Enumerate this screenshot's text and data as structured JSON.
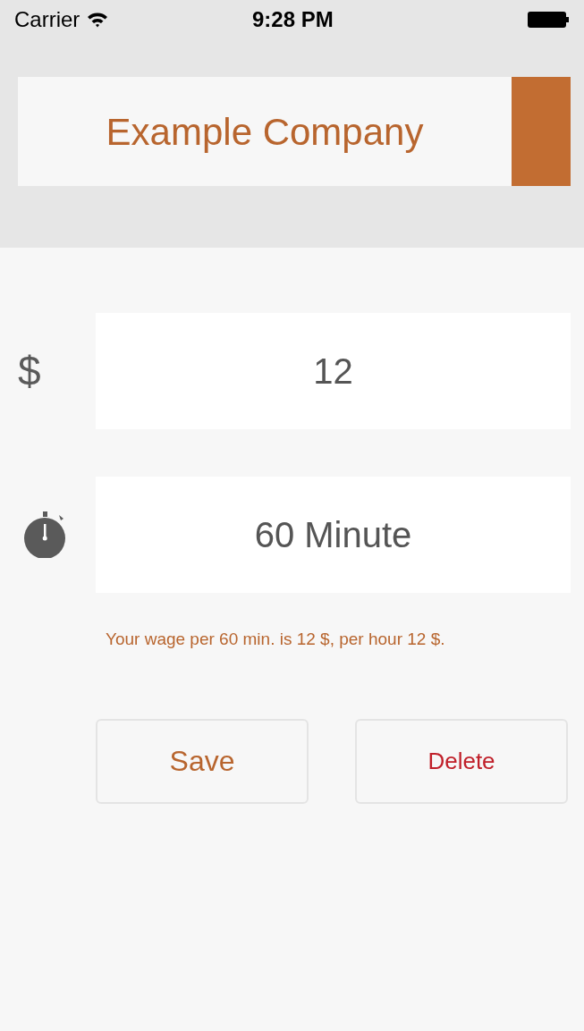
{
  "status_bar": {
    "carrier": "Carrier",
    "time": "9:28 PM"
  },
  "company": {
    "name": "Example Company"
  },
  "fields": [
    {
      "kind": "text",
      "label": "$",
      "value": "12"
    },
    {
      "kind": "stopwatch",
      "value": "60 Minute"
    }
  ],
  "summary": "Your wage per 60 min. is 12 $, per hour 12 $.",
  "buttons": [
    {
      "label": "Save",
      "kind": "primary"
    },
    {
      "label": "Delete",
      "kind": "destructive"
    }
  ]
}
